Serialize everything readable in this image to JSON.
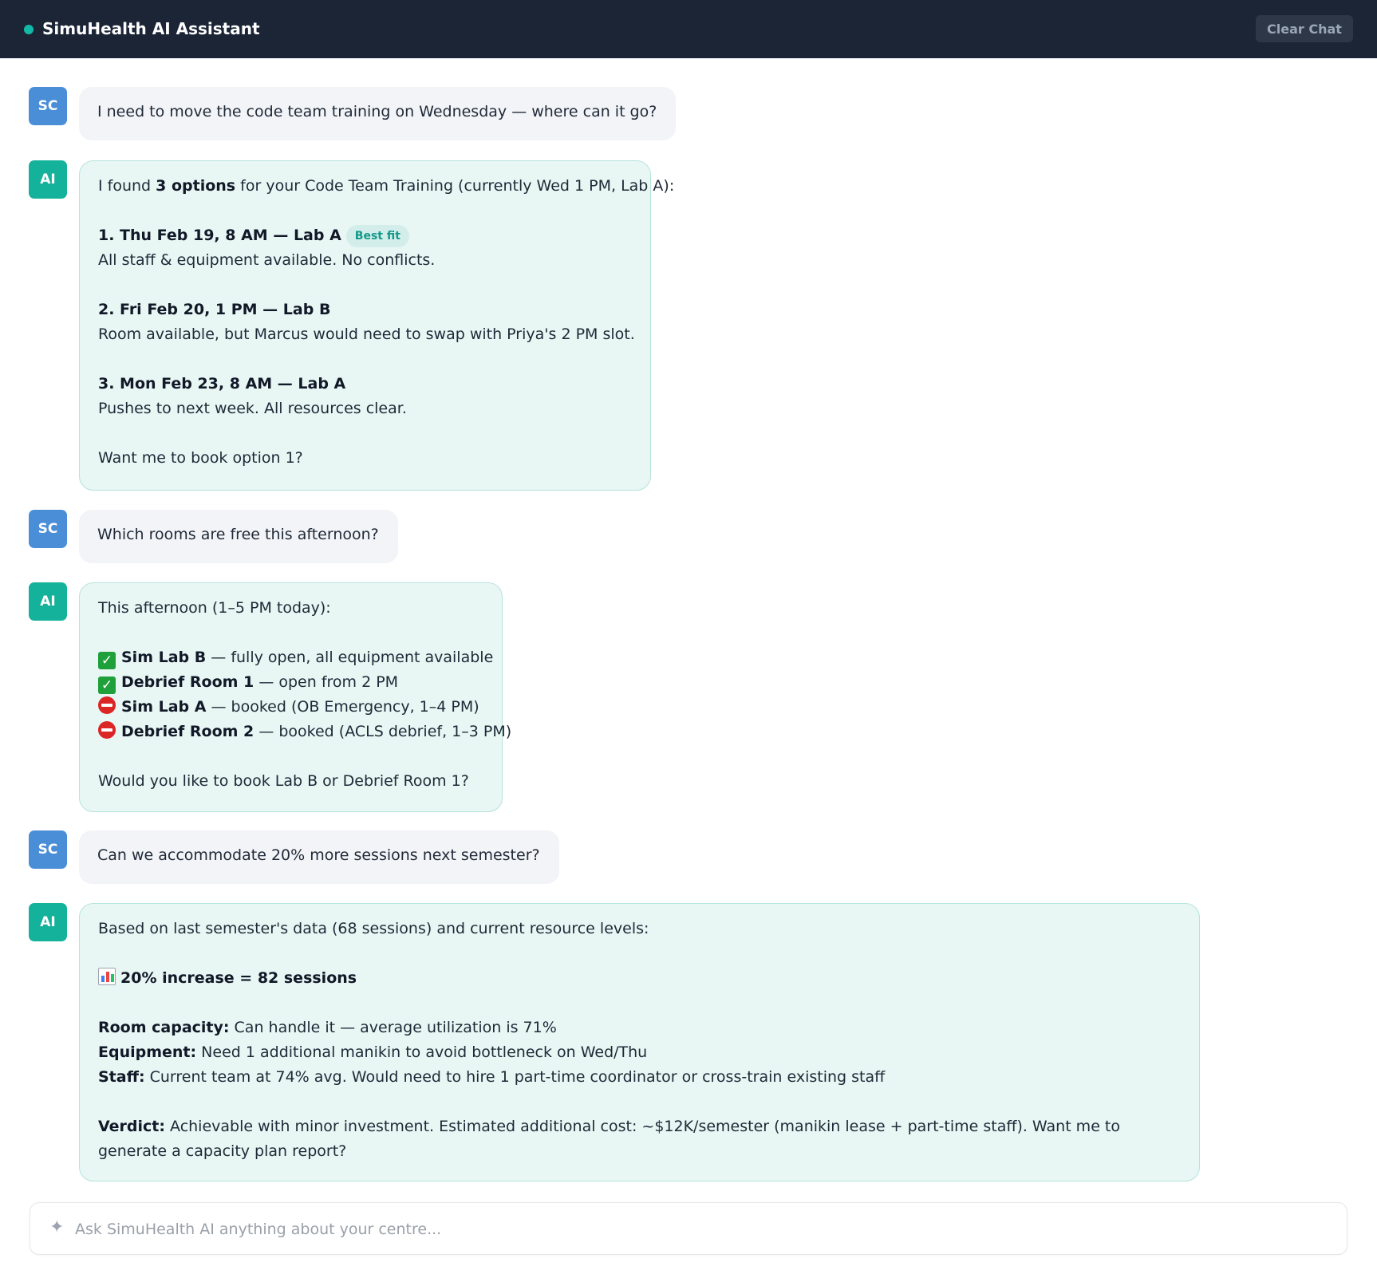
{
  "header": {
    "title": "SimuHealth AI Assistant",
    "clear_label": "Clear Chat"
  },
  "colors": {
    "header_bg": "#1b2536",
    "accent": "#14b8a6",
    "user_avatar": "#4a8ed8",
    "ai_avatar": "#14b29a",
    "ai_bubble": "#e8f6f4"
  },
  "messages": [
    {
      "role": "user",
      "avatar": "SC",
      "text": "I need to move the code team training on Wednesday — where can it go?"
    },
    {
      "role": "ai",
      "avatar": "AI",
      "intro_a": "I found ",
      "intro_bold": "3 options",
      "intro_b": " for your Code Team Training (currently Wed 1 PM, Lab A):",
      "options": [
        {
          "title": "1. Thu Feb 19, 8 AM — Lab A",
          "badge": "Best fit",
          "detail": "All staff & equipment available. No conflicts."
        },
        {
          "title": "2. Fri Feb 20, 1 PM — Lab B",
          "detail": "Room available, but Marcus would need to swap with Priya's 2 PM slot."
        },
        {
          "title": "3. Mon Feb 23, 8 AM — Lab A",
          "detail": "Pushes to next week. All resources clear."
        }
      ],
      "closing": "Want me to book option 1?"
    },
    {
      "role": "user",
      "avatar": "SC",
      "text": "Which rooms are free this afternoon?"
    },
    {
      "role": "ai",
      "avatar": "AI",
      "intro": "This afternoon (1–5 PM today):",
      "rooms": [
        {
          "status": "free",
          "icon": "check-mark-icon",
          "name": "Sim Lab B",
          "detail": " — fully open, all equipment available"
        },
        {
          "status": "free",
          "icon": "check-mark-icon",
          "name": "Debrief Room 1",
          "detail": " — open from 2 PM"
        },
        {
          "status": "booked",
          "icon": "no-entry-icon",
          "name": "Sim Lab A",
          "detail": " — booked (OB Emergency, 1–4 PM)"
        },
        {
          "status": "booked",
          "icon": "no-entry-icon",
          "name": "Debrief Room 2",
          "detail": " — booked (ACLS debrief, 1–3 PM)"
        }
      ],
      "closing": "Would you like to book Lab B or Debrief Room 1?"
    },
    {
      "role": "user",
      "avatar": "SC",
      "text": "Can we accommodate 20% more sessions next semester?"
    },
    {
      "role": "ai",
      "avatar": "AI",
      "intro": "Based on last semester's data (68 sessions) and current resource levels:",
      "headline_icon": "bar-chart-icon",
      "headline": "20% increase = 82 sessions",
      "items": [
        {
          "label": "Room capacity:",
          "text": " Can handle it — average utilization is 71%"
        },
        {
          "label": "Equipment:",
          "text": " Need 1 additional manikin to avoid bottleneck on Wed/Thu"
        },
        {
          "label": "Staff:",
          "text": " Current team at 74% avg. Would need to hire 1 part-time coordinator or cross-train existing staff"
        }
      ],
      "verdict_label": "Verdict:",
      "verdict_text": " Achievable with minor investment. Estimated additional cost: ~$12K/semester (manikin lease + part-time staff). Want me to generate a capacity plan report?"
    }
  ],
  "input": {
    "placeholder": "Ask SimuHealth AI anything about your centre...",
    "value": "",
    "icon": "sparkle-icon"
  }
}
